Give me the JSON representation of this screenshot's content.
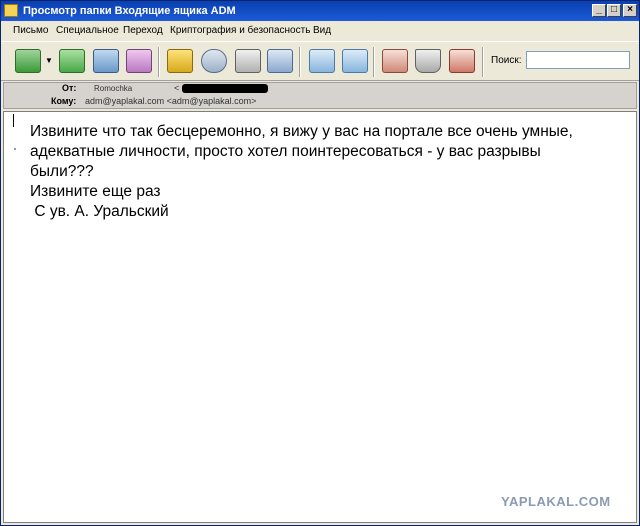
{
  "window": {
    "title": "Просмотр папки Входящие ящика ADM",
    "controls": {
      "minimize": "_",
      "maximize": "□",
      "close": "×"
    }
  },
  "menu": [
    "Письмо",
    "Специальное",
    "Переход",
    "Криптография и безопасность",
    "Вид"
  ],
  "toolbar": {
    "icons": [
      "reply-icon",
      "dropdown-arrow-icon",
      "reply-all-icon",
      "forward-icon",
      "new-message-icon",
      "address-book-icon",
      "find-icon",
      "print-icon",
      "properties-icon",
      "move-icon",
      "copy-icon",
      "delete-icon",
      "trash-icon",
      "junk-icon"
    ],
    "search_label": "Поиск:",
    "search_value": ""
  },
  "headers": {
    "from_label": "От:",
    "from_name": "Romochka",
    "from_addr_open": "<",
    "to_label": "Кому:",
    "to_value": "adm@yaplakal.com <adm@yaplakal.com>"
  },
  "message": {
    "body": "Извините что так бесцеремонно, я вижу у вас на портале все очень умные,\nадекватные личности, просто хотел поинтересоваться - у вас разрывы\nбыли???\nИзвините еще раз\n С ув. А. Уральский"
  },
  "watermark": "YAPLAKAL.COM",
  "colors": {
    "titlebar": "#0a3fb0",
    "window_bg": "#ece9d8",
    "body_bg": "#ffffff"
  }
}
